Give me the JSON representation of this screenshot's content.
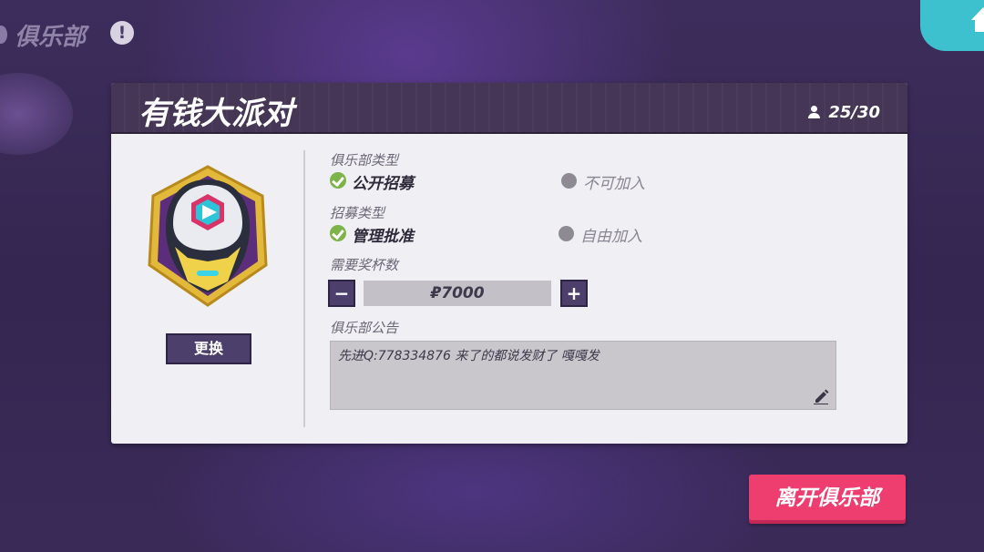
{
  "header": {
    "title": "俱乐部",
    "info_icon": "!",
    "home_icon": "home-icon"
  },
  "club": {
    "name": "有钱大派对",
    "members": "25/30",
    "change_label": "更换",
    "club_type_label": "俱乐部类型",
    "club_type_options": [
      "公开招募",
      "不可加入"
    ],
    "club_type_selected": "公开招募",
    "recruit_type_label": "招募类型",
    "recruit_type_options": [
      "管理批准",
      "自由加入"
    ],
    "recruit_type_selected": "管理批准",
    "trophy_label": "需要奖杯数",
    "trophy_value": "₽7000",
    "minus_label": "−",
    "plus_label": "+",
    "notice_label": "俱乐部公告",
    "notice_text": "先进Q:778334876 来了的都说发财了 嘎嘎发"
  },
  "leave_label": "离开俱乐部",
  "colors": {
    "accent_pink": "#ee3d6f",
    "accent_cyan": "#3ec1cf",
    "check_green": "#7cb44a",
    "button_purple": "#4c3f6c"
  }
}
